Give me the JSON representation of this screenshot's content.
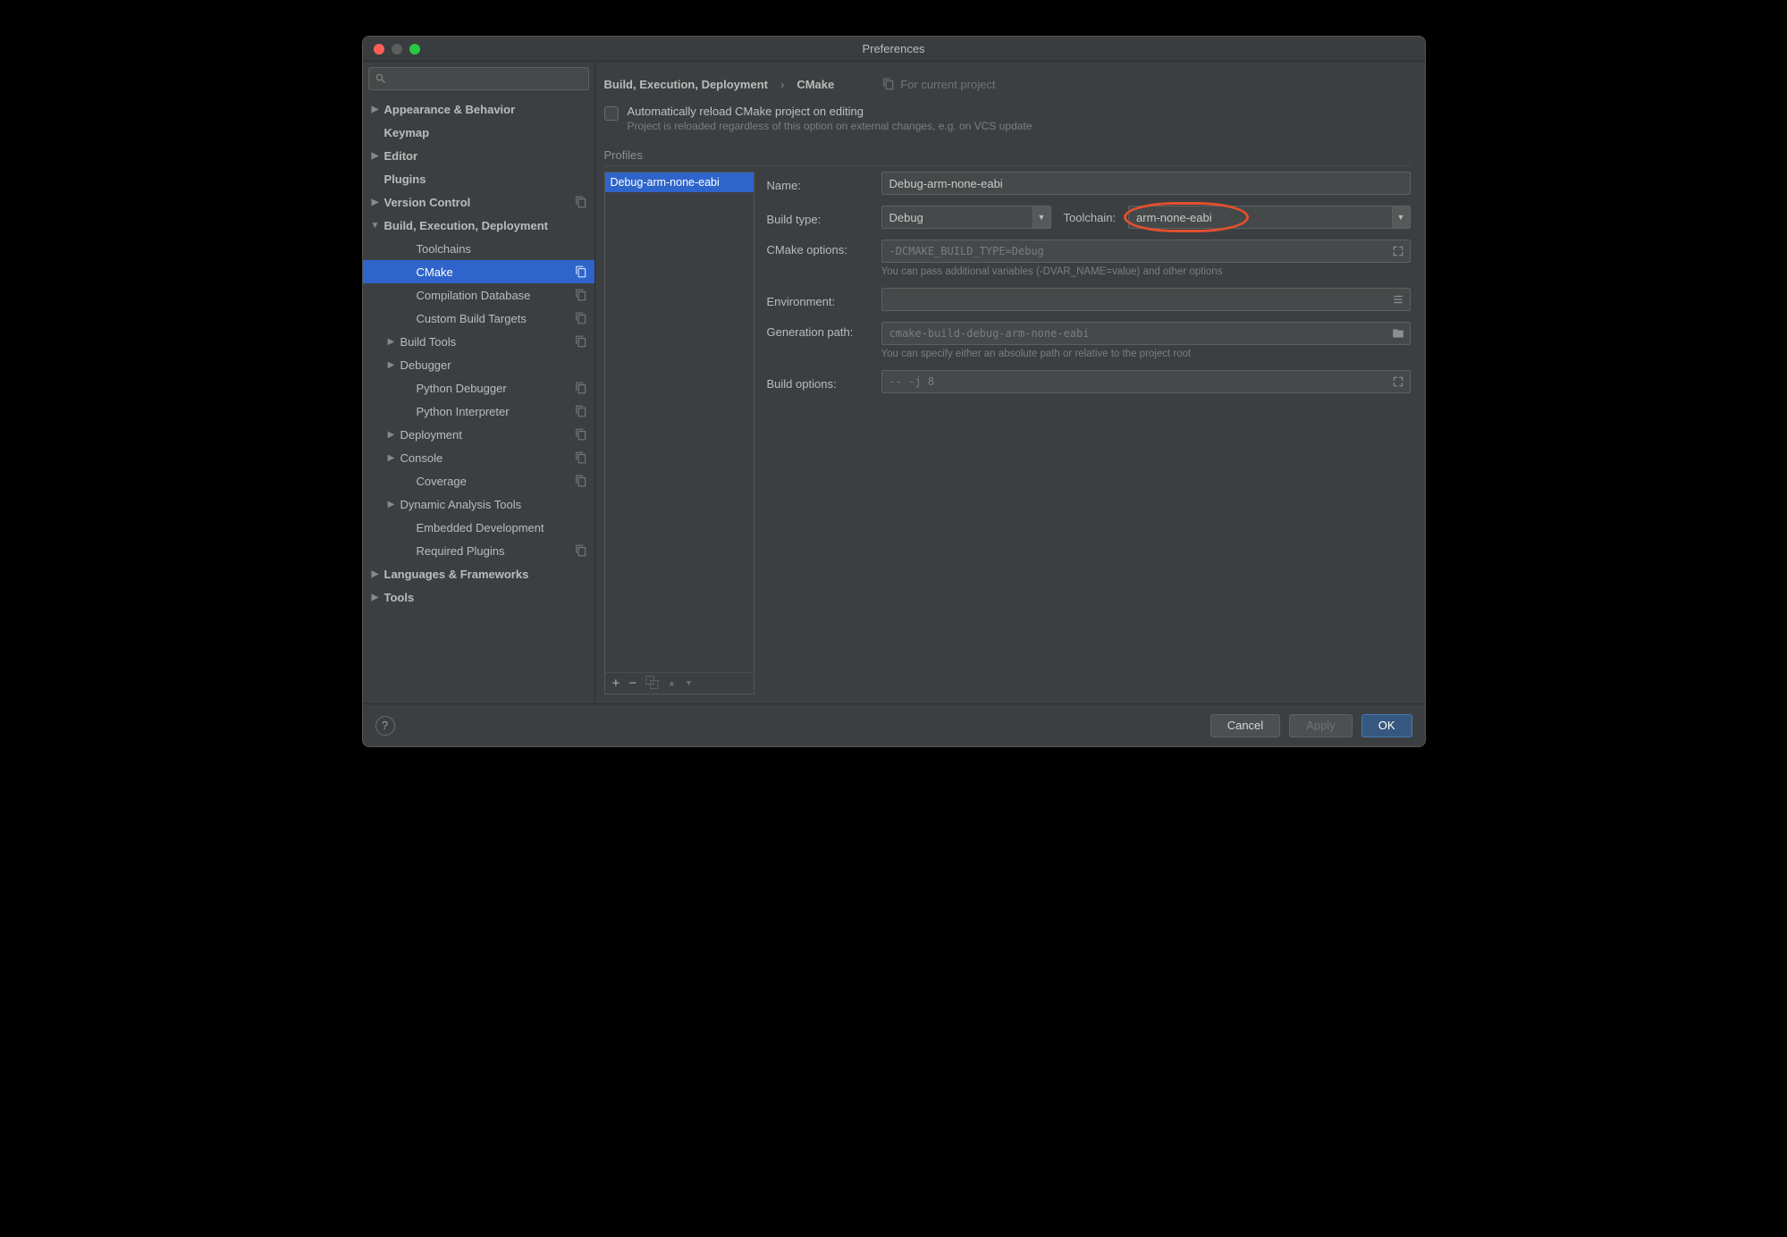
{
  "window": {
    "title": "Preferences"
  },
  "sidebar": {
    "search_placeholder": "",
    "items": [
      {
        "label": "Appearance & Behavior",
        "bold": true,
        "arrow": "▶",
        "indent": 0
      },
      {
        "label": "Keymap",
        "bold": true,
        "indent": 0
      },
      {
        "label": "Editor",
        "bold": true,
        "arrow": "▶",
        "indent": 0
      },
      {
        "label": "Plugins",
        "bold": true,
        "indent": 0
      },
      {
        "label": "Version Control",
        "bold": true,
        "arrow": "▶",
        "indent": 0,
        "badge": true
      },
      {
        "label": "Build, Execution, Deployment",
        "bold": true,
        "arrow": "▼",
        "indent": 0
      },
      {
        "label": "Toolchains",
        "indent": 2
      },
      {
        "label": "CMake",
        "indent": 2,
        "selected": true,
        "badge": true
      },
      {
        "label": "Compilation Database",
        "indent": 2,
        "badge": true
      },
      {
        "label": "Custom Build Targets",
        "indent": 2,
        "badge": true
      },
      {
        "label": "Build Tools",
        "arrow": "▶",
        "indent": 1,
        "badge": true
      },
      {
        "label": "Debugger",
        "arrow": "▶",
        "indent": 1
      },
      {
        "label": "Python Debugger",
        "indent": 2,
        "badge": true
      },
      {
        "label": "Python Interpreter",
        "indent": 2,
        "badge": true
      },
      {
        "label": "Deployment",
        "arrow": "▶",
        "indent": 1,
        "badge": true
      },
      {
        "label": "Console",
        "arrow": "▶",
        "indent": 1,
        "badge": true
      },
      {
        "label": "Coverage",
        "indent": 2,
        "badge": true
      },
      {
        "label": "Dynamic Analysis Tools",
        "arrow": "▶",
        "indent": 1
      },
      {
        "label": "Embedded Development",
        "indent": 2
      },
      {
        "label": "Required Plugins",
        "indent": 2,
        "badge": true
      },
      {
        "label": "Languages & Frameworks",
        "bold": true,
        "arrow": "▶",
        "indent": 0
      },
      {
        "label": "Tools",
        "bold": true,
        "arrow": "▶",
        "indent": 0
      }
    ]
  },
  "breadcrumb": {
    "crumb1": "Build, Execution, Deployment",
    "sep": "›",
    "crumb2": "CMake",
    "scope": "For current project"
  },
  "checkbox": {
    "label": "Automatically reload CMake project on editing",
    "desc": "Project is reloaded regardless of this option on external changes, e.g. on VCS update"
  },
  "profiles": {
    "header": "Profiles",
    "items": [
      "Debug-arm-none-eabi"
    ],
    "toolbar": {
      "add": "+",
      "remove": "−",
      "copy": "⿻",
      "up": "▲",
      "down": "▼"
    }
  },
  "form": {
    "name_label": "Name:",
    "name_value": "Debug-arm-none-eabi",
    "buildtype_label": "Build type:",
    "buildtype_value": "Debug",
    "toolchain_label": "Toolchain:",
    "toolchain_value": "arm-none-eabi",
    "cmakeopts_label": "CMake options:",
    "cmakeopts_placeholder": "-DCMAKE_BUILD_TYPE=Debug",
    "cmakeopts_hint": "You can pass additional variables (-DVAR_NAME=value) and other options",
    "env_label": "Environment:",
    "genpath_label": "Generation path:",
    "genpath_placeholder": "cmake-build-debug-arm-none-eabi",
    "genpath_hint": "You can specify either an absolute path or relative to the project root",
    "buildopts_label": "Build options:",
    "buildopts_placeholder": "-- -j 8"
  },
  "footer": {
    "cancel": "Cancel",
    "apply": "Apply",
    "ok": "OK"
  }
}
